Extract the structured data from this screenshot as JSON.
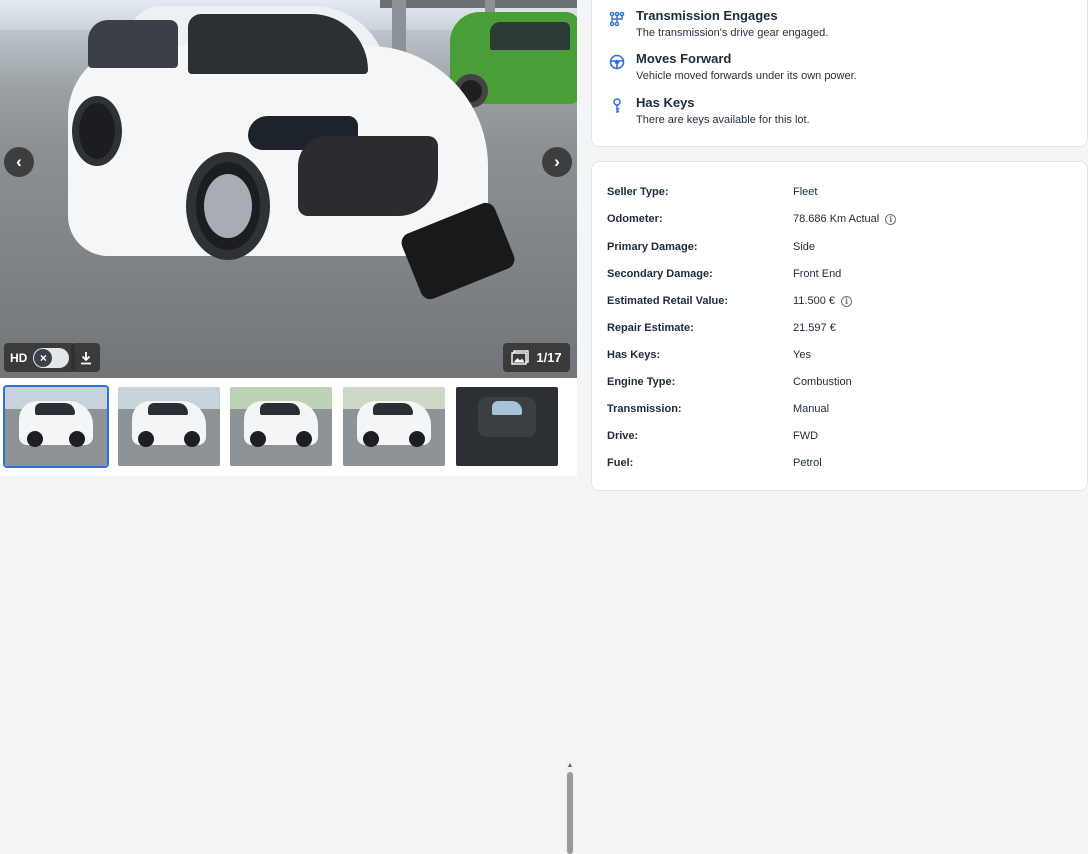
{
  "gallery": {
    "hd_label": "HD",
    "counter": "1/17",
    "thumbnails": [
      "exterior-front-right",
      "exterior-front",
      "exterior-rear-left",
      "exterior-rear-right",
      "interior-dashboard"
    ]
  },
  "highlights": [
    {
      "icon": "transmission-icon",
      "title": "Transmission Engages",
      "description": "The transmission's drive gear engaged."
    },
    {
      "icon": "steering-wheel-icon",
      "title": "Moves Forward",
      "description": "Vehicle moved forwards under its own power."
    },
    {
      "icon": "key-icon",
      "title": "Has Keys",
      "description": "There are keys available for this lot."
    }
  ],
  "specs": [
    {
      "label": "Seller Type:",
      "value": "Fleet",
      "info": false
    },
    {
      "label": "Odometer:",
      "value": "78.686 Km Actual",
      "info": true
    },
    {
      "label": "Primary Damage:",
      "value": "Side",
      "info": false
    },
    {
      "label": "Secondary Damage:",
      "value": "Front End",
      "info": false
    },
    {
      "label": "Estimated Retail Value:",
      "value": "11.500 €",
      "info": true
    },
    {
      "label": "Repair Estimate:",
      "value": "21.597 €",
      "info": false
    },
    {
      "label": "Has Keys:",
      "value": "Yes",
      "info": false
    },
    {
      "label": "Engine Type:",
      "value": "Combustion",
      "info": false
    },
    {
      "label": "Transmission:",
      "value": "Manual",
      "info": false
    },
    {
      "label": "Drive:",
      "value": "FWD",
      "info": false
    },
    {
      "label": "Fuel:",
      "value": "Petrol",
      "info": false
    }
  ],
  "colors": {
    "accent": "#2f6fd6",
    "text": "#1d2b3a",
    "border": "#e1e4e8"
  }
}
